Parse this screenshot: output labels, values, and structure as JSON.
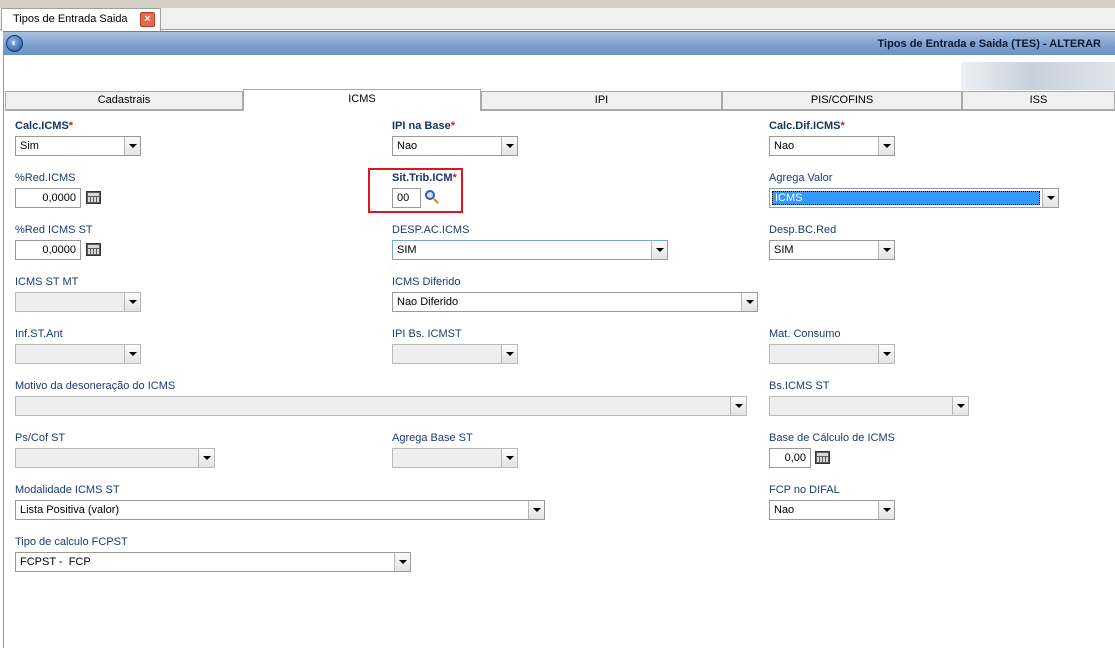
{
  "doc_tab": {
    "label": "Tipos de Entrada Saida",
    "close": "×"
  },
  "window": {
    "title": "Tipos de Entrada e Saida (TES) - ALTERAR"
  },
  "tabs": [
    "Cadastrais",
    "ICMS",
    "IPI",
    "PIS/COFINS",
    "ISS"
  ],
  "active_tab": "ICMS",
  "required_marker": "*",
  "fields": {
    "calc_icms": {
      "label": "Calc.ICMS",
      "value": "Sim"
    },
    "ipi_na_base": {
      "label": "IPI na Base",
      "value": "Nao"
    },
    "calc_dif_icms": {
      "label": "Calc.Dif.ICMS",
      "value": "Nao"
    },
    "red_icms": {
      "label": "%Red.ICMS",
      "value": "0,0000"
    },
    "sit_trib_icm": {
      "label": "Sit.Trib.ICM",
      "value": "00"
    },
    "agrega_valor": {
      "label": "Agrega Valor",
      "value": "ICMS"
    },
    "red_icms_st": {
      "label": "%Red ICMS ST",
      "value": "0,0000"
    },
    "desp_ac_icms": {
      "label": "DESP.AC.ICMS",
      "value": "SIM"
    },
    "desp_bc_red": {
      "label": "Desp.BC.Red",
      "value": "SIM"
    },
    "icms_st_mt": {
      "label": "ICMS ST MT",
      "value": ""
    },
    "icms_diferido": {
      "label": "ICMS Diferido",
      "value": "Nao Diferido"
    },
    "inf_st_ant": {
      "label": "Inf.ST.Ant",
      "value": ""
    },
    "ipi_bs_icmst": {
      "label": "IPI Bs. ICMST",
      "value": ""
    },
    "mat_consumo": {
      "label": "Mat. Consumo",
      "value": ""
    },
    "motivo_desoneracao": {
      "label": "Motivo da desoneração do ICMS",
      "value": ""
    },
    "bs_icms_st": {
      "label": "Bs.ICMS ST",
      "value": ""
    },
    "ps_cof_st": {
      "label": "Ps/Cof ST",
      "value": ""
    },
    "agrega_base_st": {
      "label": "Agrega Base ST",
      "value": ""
    },
    "base_calculo_icms": {
      "label": "Base de Cálculo de ICMS",
      "value": "0,00"
    },
    "modalidade_icms_st": {
      "label": "Modalidade ICMS ST",
      "value": "Lista Positiva (valor)"
    },
    "fcp_no_difal": {
      "label": "FCP no DIFAL",
      "value": "Nao"
    },
    "tipo_calculo_fcpst": {
      "label": "Tipo de calculo FCPST",
      "value": "FCPST -  FCP"
    }
  },
  "colors": {
    "title_bar": "#7fa1cf",
    "label": "#1b3c6e",
    "required": "#d42020",
    "highlight": "#e0141e",
    "selection": "#3399ff"
  }
}
